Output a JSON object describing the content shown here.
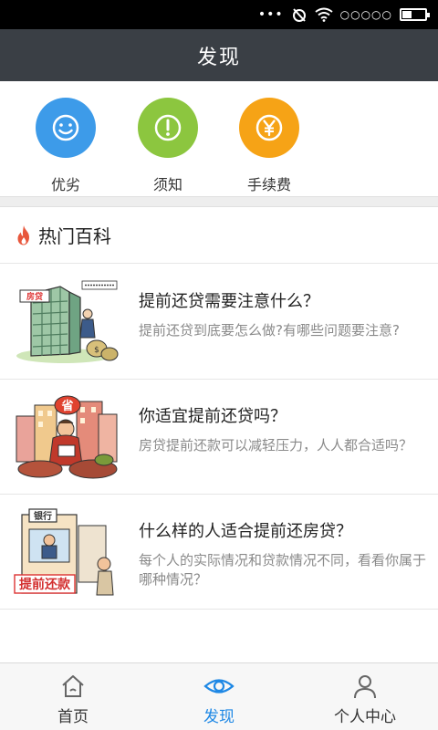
{
  "status_bar": {
    "dots": "•••",
    "signal": "○○○○○"
  },
  "header": {
    "title": "发现"
  },
  "quick_links": [
    {
      "label": "优劣",
      "icon": "smile-icon",
      "color": "#3d9be9"
    },
    {
      "label": "须知",
      "icon": "exclamation-icon",
      "color": "#8cc63f"
    },
    {
      "label": "手续费",
      "icon": "yen-icon",
      "color": "#f6a316"
    }
  ],
  "section": {
    "title": "热门百科",
    "icon": "fire-icon",
    "icon_color": "#e8573c"
  },
  "articles": [
    {
      "title": "提前还贷需要注意什么？",
      "desc": "提前还贷到底要怎么做?有哪些问题要注意?"
    },
    {
      "title": "你适宜提前还贷吗？",
      "desc": "房贷提前还款可以减轻压力，人人都合适吗？"
    },
    {
      "title": "什么样的人适合提前还房贷？",
      "desc": "每个人的实际情况和贷款情况不同，看看你属于哪种情况？"
    }
  ],
  "thumbnails": {
    "sign_text_1": "房贷",
    "sign_text_2": "省",
    "sign_text_3": "银行",
    "banner_text_3": "提前还款"
  },
  "tabs": [
    {
      "label": "首页",
      "icon": "home-icon",
      "active": false
    },
    {
      "label": "发现",
      "icon": "eye-icon",
      "active": true
    },
    {
      "label": "个人中心",
      "icon": "person-icon",
      "active": false
    }
  ],
  "colors": {
    "accent": "#1e88e5",
    "titlebar": "#3a3f45"
  }
}
